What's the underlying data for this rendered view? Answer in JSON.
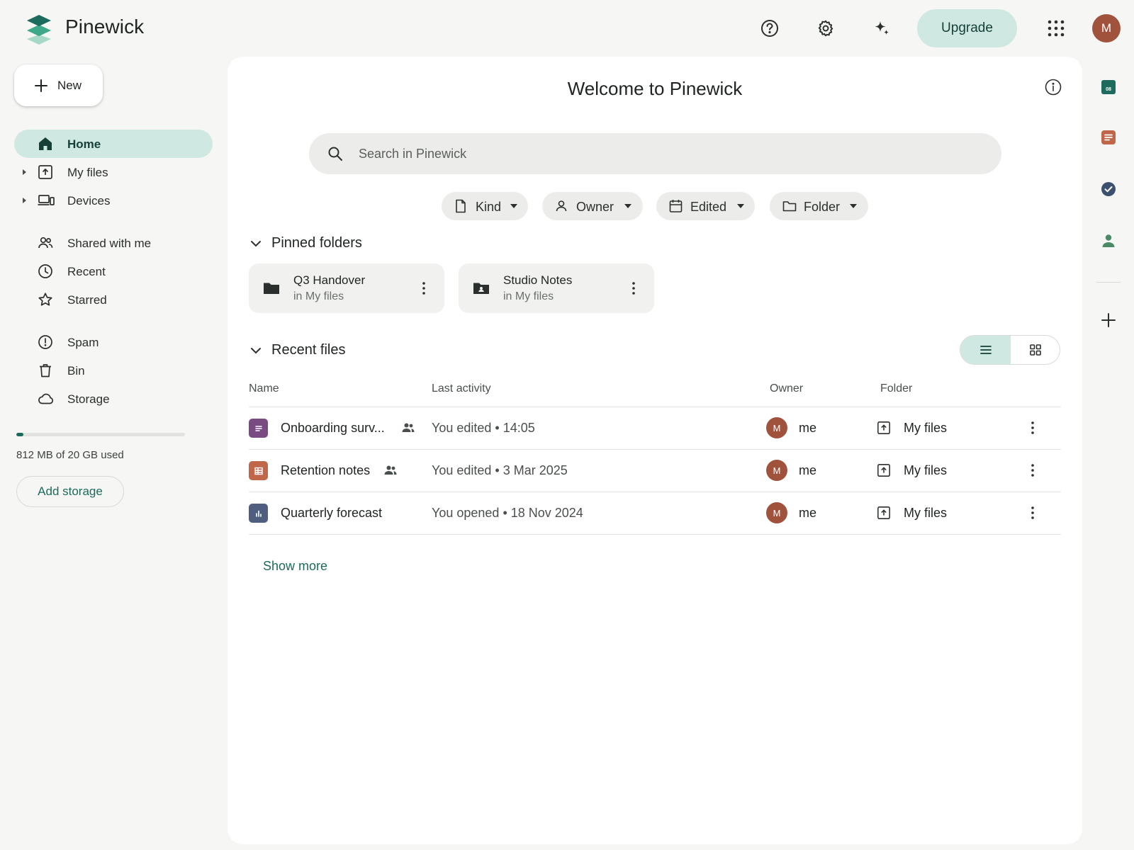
{
  "app": {
    "brand": "Pinewick"
  },
  "header": {
    "upgrade_label": "Upgrade",
    "avatar_initial": "M",
    "icons": [
      "help-circle-icon",
      "gear-icon",
      "sparkle-icon",
      "apps-grid-icon"
    ]
  },
  "sidebar": {
    "new_label": "New",
    "items": [
      {
        "label": "Home",
        "icon": "home-icon",
        "active": true
      },
      {
        "label": "My files",
        "icon": "upload-box-icon",
        "expandable": true
      },
      {
        "label": "Devices",
        "icon": "devices-icon",
        "expandable": true
      },
      {
        "label": "Shared with me",
        "icon": "people-icon"
      },
      {
        "label": "Recent",
        "icon": "clock-icon"
      },
      {
        "label": "Starred",
        "icon": "star-icon"
      },
      {
        "label": "Spam",
        "icon": "alert-icon"
      },
      {
        "label": "Bin",
        "icon": "trash-icon"
      },
      {
        "label": "Storage",
        "icon": "cloud-icon"
      }
    ],
    "storage": {
      "text": "812 MB of 20 GB used",
      "used_fraction": 0.04
    },
    "add_storage_label": "Add storage"
  },
  "main": {
    "title": "Welcome to Pinewick",
    "search_placeholder": "Search in Pinewick",
    "filters": [
      {
        "label": "Kind",
        "icon": "file-icon"
      },
      {
        "label": "Owner",
        "icon": "person-icon"
      },
      {
        "label": "Edited",
        "icon": "calendar-icon"
      },
      {
        "label": "Folder",
        "icon": "folder-outline-icon"
      }
    ],
    "pinned": {
      "title": "Pinned folders",
      "folders": [
        {
          "name": "Q3 Handover",
          "location": "in My files",
          "icon": "folder-icon"
        },
        {
          "name": "Studio Notes",
          "location": "in My files",
          "icon": "shared-folder-icon"
        }
      ]
    },
    "recent": {
      "title": "Recent files",
      "columns": {
        "name": "Name",
        "activity": "Last activity",
        "owner": "Owner",
        "folder": "Folder"
      },
      "files": [
        {
          "name": "Onboarding surv...",
          "type": "form",
          "color": "#7a4a82",
          "shared": true,
          "activity": "You edited • 14:05",
          "owner": "me",
          "owner_initial": "M",
          "folder": "My files"
        },
        {
          "name": "Retention notes",
          "type": "sheet",
          "color": "#c0674a",
          "shared": true,
          "activity": "You edited • 3 Mar 2025",
          "owner": "me",
          "owner_initial": "M",
          "folder": "My files"
        },
        {
          "name": "Quarterly forecast",
          "type": "chart",
          "color": "#4f5e7e",
          "shared": false,
          "activity": "You opened • 18 Nov 2024",
          "owner": "me",
          "owner_initial": "M",
          "folder": "My files"
        }
      ],
      "show_more": "Show more"
    }
  },
  "right_rail": {
    "calendar_day": "08",
    "icons": [
      "calendar-app-icon",
      "notes-app-icon",
      "tasks-app-icon",
      "contacts-app-icon",
      "add-app-icon"
    ]
  },
  "colors": {
    "accent": "#1d6b5c",
    "accent_light": "#cfe8e1",
    "avatar": "#a0523c",
    "background": "#f6f6f4"
  }
}
